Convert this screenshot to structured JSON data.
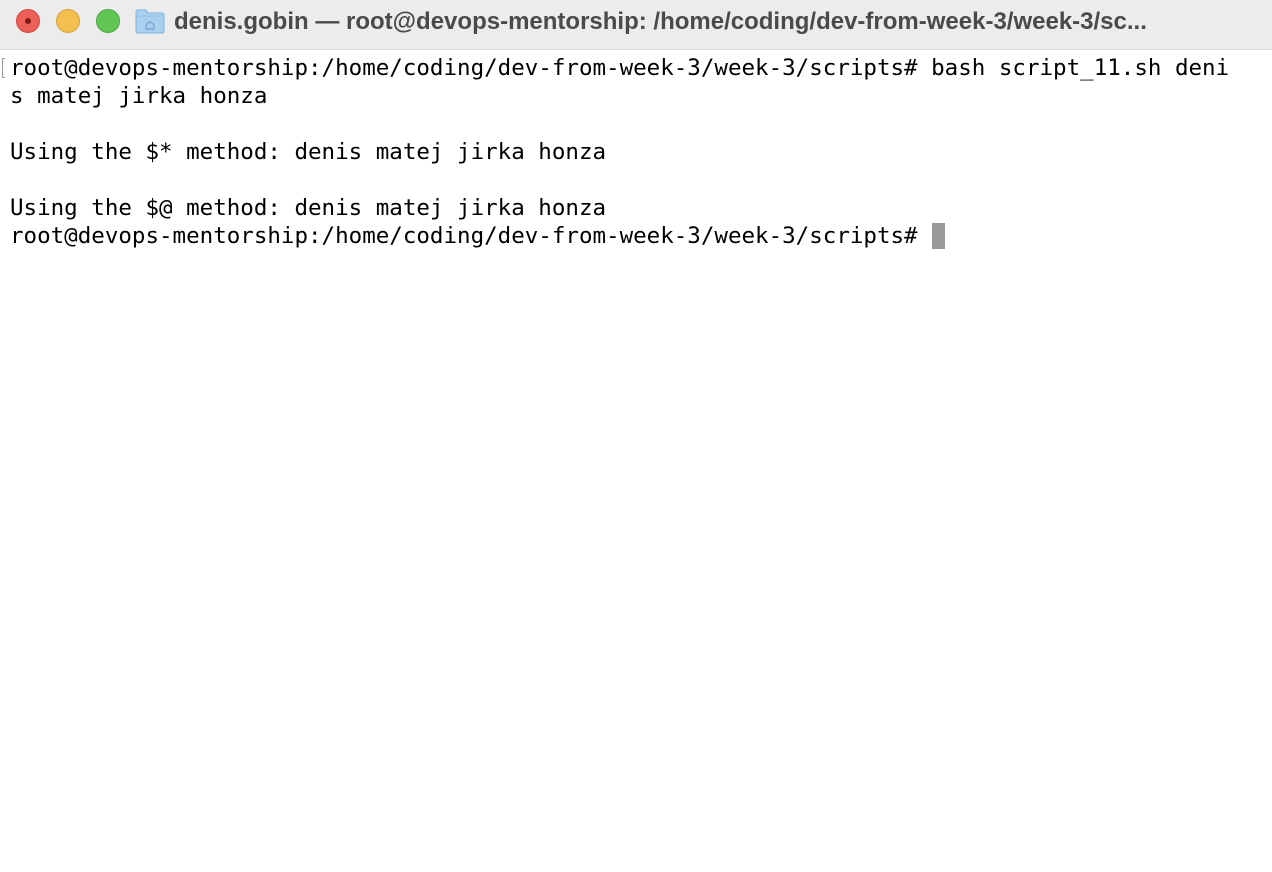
{
  "window": {
    "title": "denis.gobin — root@devops-mentorship: /home/coding/dev-from-week-3/week-3/sc..."
  },
  "icons": {
    "close": "close-icon",
    "minimize": "minimize-icon",
    "maximize": "maximize-icon",
    "folder": "home-folder-icon",
    "cursor": "block-cursor"
  },
  "colors": {
    "close": "#ec5f57",
    "minimize": "#f4bf4f",
    "maximize": "#62c655",
    "cursor": "#9a9a9a"
  },
  "terminal": {
    "lines": [
      "root@devops-mentorship:/home/coding/dev-from-week-3/week-3/scripts# bash script_11.sh deni",
      "s matej jirka honza",
      "",
      "Using the $* method: denis matej jirka honza",
      "",
      "Using the $@ method: denis matej jirka honza"
    ],
    "prompt": "root@devops-mentorship:/home/coding/dev-from-week-3/week-3/scripts# "
  }
}
